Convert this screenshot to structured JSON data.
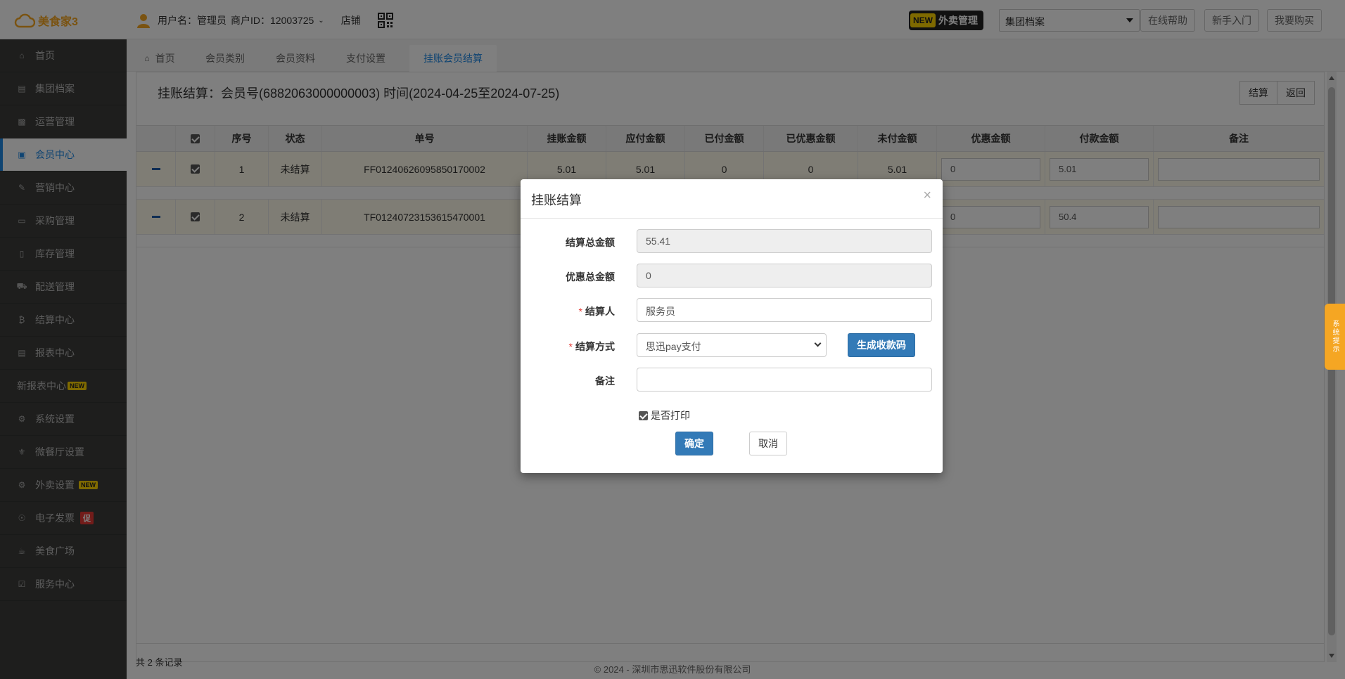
{
  "app": {
    "logo_text": "美食家3",
    "user_label": "用户名：管理员",
    "merchant_label": "商户ID：12003725",
    "store_label": "店铺",
    "takeout_new": "NEW",
    "takeout_label": "外卖管理",
    "group_select_value": "集团档案",
    "buttons": {
      "help": "在线帮助",
      "newbie": "新手入门",
      "buy": "我要购买"
    },
    "copyright": "© 2024 - 深圳市思迅软件股份有限公司",
    "sys_tip": "系统提示"
  },
  "sidebar": {
    "items": [
      {
        "label": "首页",
        "icon": "home-icon"
      },
      {
        "label": "集团档案",
        "icon": "file-icon"
      },
      {
        "label": "运营管理",
        "icon": "bar-chart-icon"
      },
      {
        "label": "会员中心",
        "icon": "id-card-icon"
      },
      {
        "label": "营销中心",
        "icon": "edit-icon"
      },
      {
        "label": "采购管理",
        "icon": "book-icon"
      },
      {
        "label": "库存管理",
        "icon": "document-icon"
      },
      {
        "label": "配送管理",
        "icon": "truck-icon"
      },
      {
        "label": "结算中心",
        "icon": "bitcoin-icon"
      },
      {
        "label": "报表中心",
        "icon": "report-icon"
      },
      {
        "label": "新报表中心",
        "tag": "NEW"
      },
      {
        "label": "系统设置",
        "icon": "gears-icon"
      },
      {
        "label": "微餐厅设置",
        "icon": "cutlery-icon"
      },
      {
        "label": "外卖设置",
        "icon": "gear-icon",
        "tag": "NEW"
      },
      {
        "label": "电子发票",
        "icon": "compass-icon",
        "promo": "促"
      },
      {
        "label": "美食广场",
        "icon": "coffee-icon"
      },
      {
        "label": "服务中心",
        "icon": "check-square-icon"
      }
    ]
  },
  "tabs": [
    "首页",
    "会员类别",
    "会员资料",
    "支付设置",
    "挂账会员结算"
  ],
  "page": {
    "title": "挂账结算：会员号(6882063000000003) 时间(2024-04-25至2024-07-25)",
    "settle_btn": "结算",
    "back_btn": "返回",
    "columns": [
      "序号",
      "状态",
      "单号",
      "挂账金额",
      "应付金额",
      "已付金额",
      "已优惠金额",
      "未付金额",
      "优惠金额",
      "付款金额",
      "备注"
    ],
    "rows": [
      {
        "no": "1",
        "status": "未结算",
        "order": "FF01240626095850170002",
        "credit": "5.01",
        "payable": "5.01",
        "paid": "0",
        "discounted": "0",
        "unpaid": "5.01",
        "discount_input": "0",
        "pay_input": "5.01",
        "remark": ""
      },
      {
        "no": "2",
        "status": "未结算",
        "order": "TF01240723153615470001",
        "credit": "",
        "payable": "",
        "paid": "",
        "discounted": "",
        "unpaid": "",
        "discount_input": "0",
        "pay_input": "50.4",
        "remark": ""
      }
    ],
    "record_count": "共 2 条记录"
  },
  "modal": {
    "title": "挂账结算",
    "close": "×",
    "total_label": "结算总金额",
    "total_value": "55.41",
    "discount_total_label": "优惠总金额",
    "discount_total_value": "0",
    "settler_label": "结算人",
    "settler_value": "服务员",
    "method_label": "结算方式",
    "method_value": "思迅pay支付",
    "qr_btn": "生成收款码",
    "remark_label": "备注",
    "remark_value": "",
    "print_label": "是否打印",
    "confirm": "确定",
    "cancel": "取消"
  },
  "colors": {
    "accent": "#1e88e5",
    "primary_button": "#337ab7",
    "sidebar_bg": "#3c3d3b",
    "row_highlight": "#fffbea",
    "logo": "#f5a623"
  }
}
